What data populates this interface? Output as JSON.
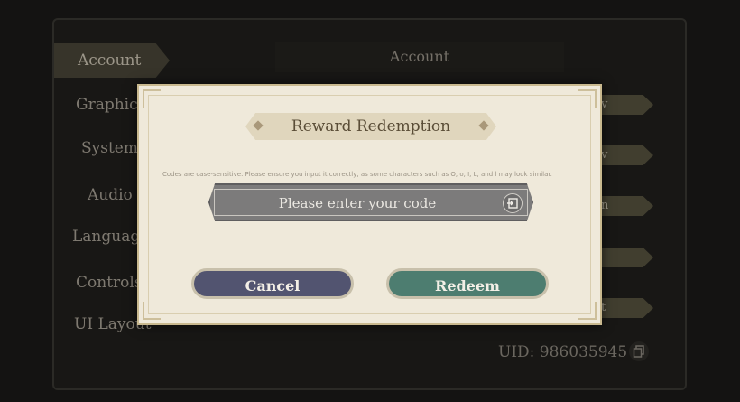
{
  "settings": {
    "active_tab": "Account",
    "nav_items": [
      "Graphics",
      "System",
      "Audio",
      "Language",
      "Controls",
      "UI Layout"
    ],
    "section_title": "Account",
    "right_buttons": [
      "v",
      "v",
      "n",
      "",
      "t"
    ],
    "uid_text": "UID: 986035945"
  },
  "dialog": {
    "title": "Reward Redemption",
    "hint": "Codes are case-sensitive. Please ensure you input it correctly, as some characters such as O, o, I, L, and l may look similar.",
    "input": {
      "value": "",
      "placeholder": "Please enter your code"
    },
    "cancel_label": "Cancel",
    "redeem_label": "Redeem"
  },
  "icons": {
    "paste": "paste-icon",
    "copy": "copy-icon"
  },
  "colors": {
    "cancel": "#525470",
    "redeem": "#4d7d70",
    "dialog_bg": "#efe9da"
  }
}
